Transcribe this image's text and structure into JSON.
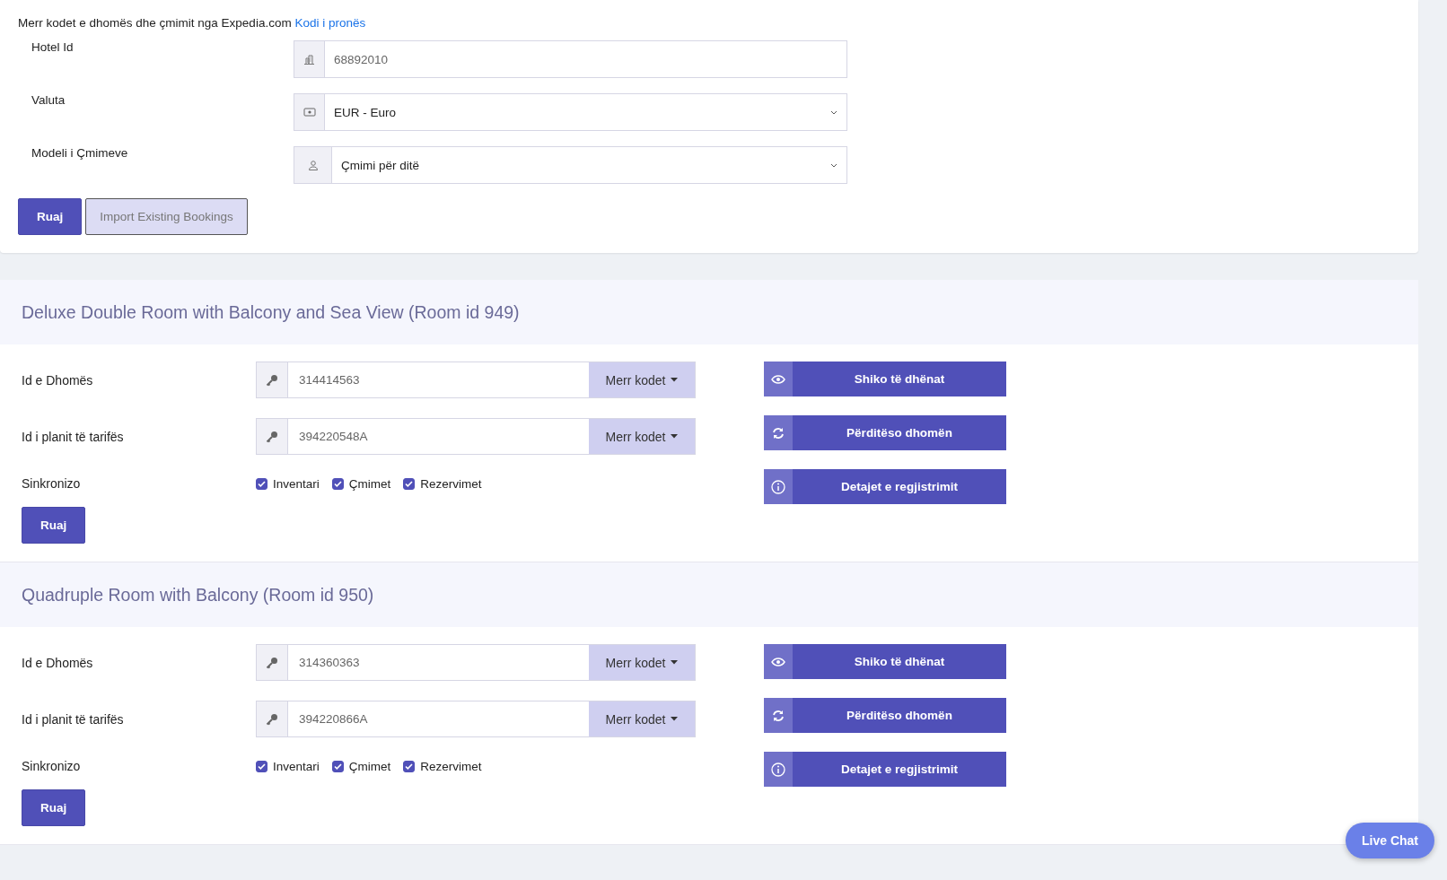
{
  "intro": {
    "text": "Merr kodet e dhomës dhe çmimit nga Expedia.com",
    "link": "Kodi i pronës"
  },
  "settings": [
    {
      "label": "Hotel Id",
      "value": "68892010",
      "kind": "input"
    },
    {
      "label": "Valuta",
      "value": "EUR - Euro",
      "kind": "select"
    },
    {
      "label": "Modeli i Çmimeve",
      "value": "Çmimi për ditë",
      "kind": "select"
    }
  ],
  "settings_buttons": {
    "save": "Ruaj",
    "import": "Import Existing Bookings"
  },
  "rooms": [
    {
      "title": "Deluxe Double Room with Balcony and Sea View (Room id 949)",
      "fields": [
        {
          "label": "Id e Dhomës",
          "value": "314414563",
          "button": "Merr kodet"
        },
        {
          "label": "Id i planit të tarifës",
          "value": "394220548A",
          "button": "Merr kodet"
        }
      ],
      "sync_label": "Sinkronizo",
      "sync": [
        {
          "label": "Inventari",
          "checked": true
        },
        {
          "label": "Çmimet",
          "checked": true
        },
        {
          "label": "Rezervimet",
          "checked": true
        }
      ],
      "actions": [
        "Shiko të dhënat",
        "Përditëso dhomën",
        "Detajet e regjistrimit"
      ],
      "save": "Ruaj"
    },
    {
      "title": "Quadruple Room with Balcony (Room id 950)",
      "fields": [
        {
          "label": "Id e Dhomës",
          "value": "314360363",
          "button": "Merr kodet"
        },
        {
          "label": "Id i planit të tarifës",
          "value": "394220866A",
          "button": "Merr kodet"
        }
      ],
      "sync_label": "Sinkronizo",
      "sync": [
        {
          "label": "Inventari",
          "checked": true
        },
        {
          "label": "Çmimet",
          "checked": true
        },
        {
          "label": "Rezervimet",
          "checked": true
        }
      ],
      "actions": [
        "Shiko të dhënat",
        "Përditëso dhomën",
        "Detajet e regjistrimit"
      ],
      "save": "Ruaj"
    }
  ],
  "live_chat": "Live Chat"
}
